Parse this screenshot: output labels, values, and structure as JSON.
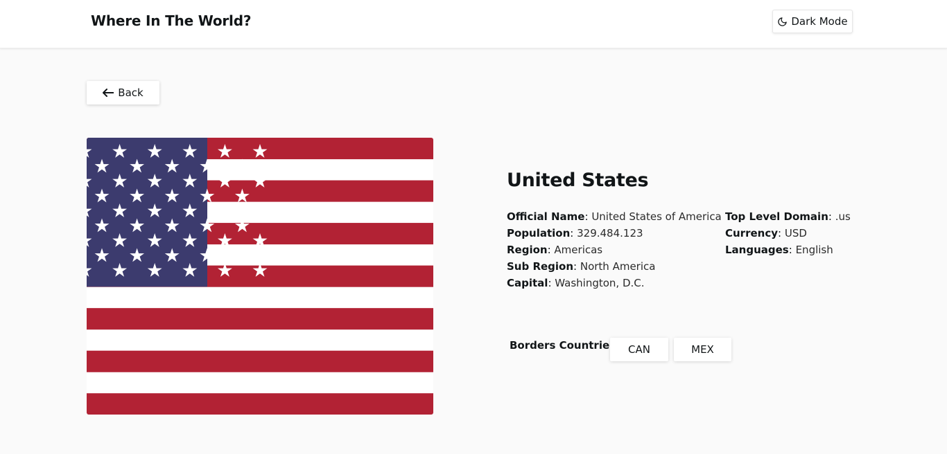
{
  "header": {
    "title": "Where In The World?",
    "dark_mode_label": "Dark Mode",
    "dark_mode_icon": "moon-icon"
  },
  "back_button": {
    "label": "Back",
    "icon": "arrow-left-icon"
  },
  "country": {
    "name": "United States",
    "flag_icon": "us-flag-image",
    "details_left": [
      {
        "key": "Official Name",
        "value": "United States of America"
      },
      {
        "key": "Population",
        "value": "329.484.123"
      },
      {
        "key": "Region",
        "value": "Americas"
      },
      {
        "key": "Sub Region",
        "value": "North America"
      },
      {
        "key": "Capital",
        "value": "Washington, D.C."
      }
    ],
    "details_right": [
      {
        "key": "Top Level Domain",
        "value": ".us"
      },
      {
        "key": "Currency",
        "value": "USD"
      },
      {
        "key": "Languages",
        "value": "English"
      }
    ],
    "borders_label": "Borders Countries",
    "borders": [
      "CAN",
      "MEX"
    ]
  },
  "colors": {
    "background": "#fafafa",
    "surface": "#ffffff",
    "text": "#111517",
    "flag_red": "#b22234",
    "flag_blue": "#3c3b6e"
  }
}
